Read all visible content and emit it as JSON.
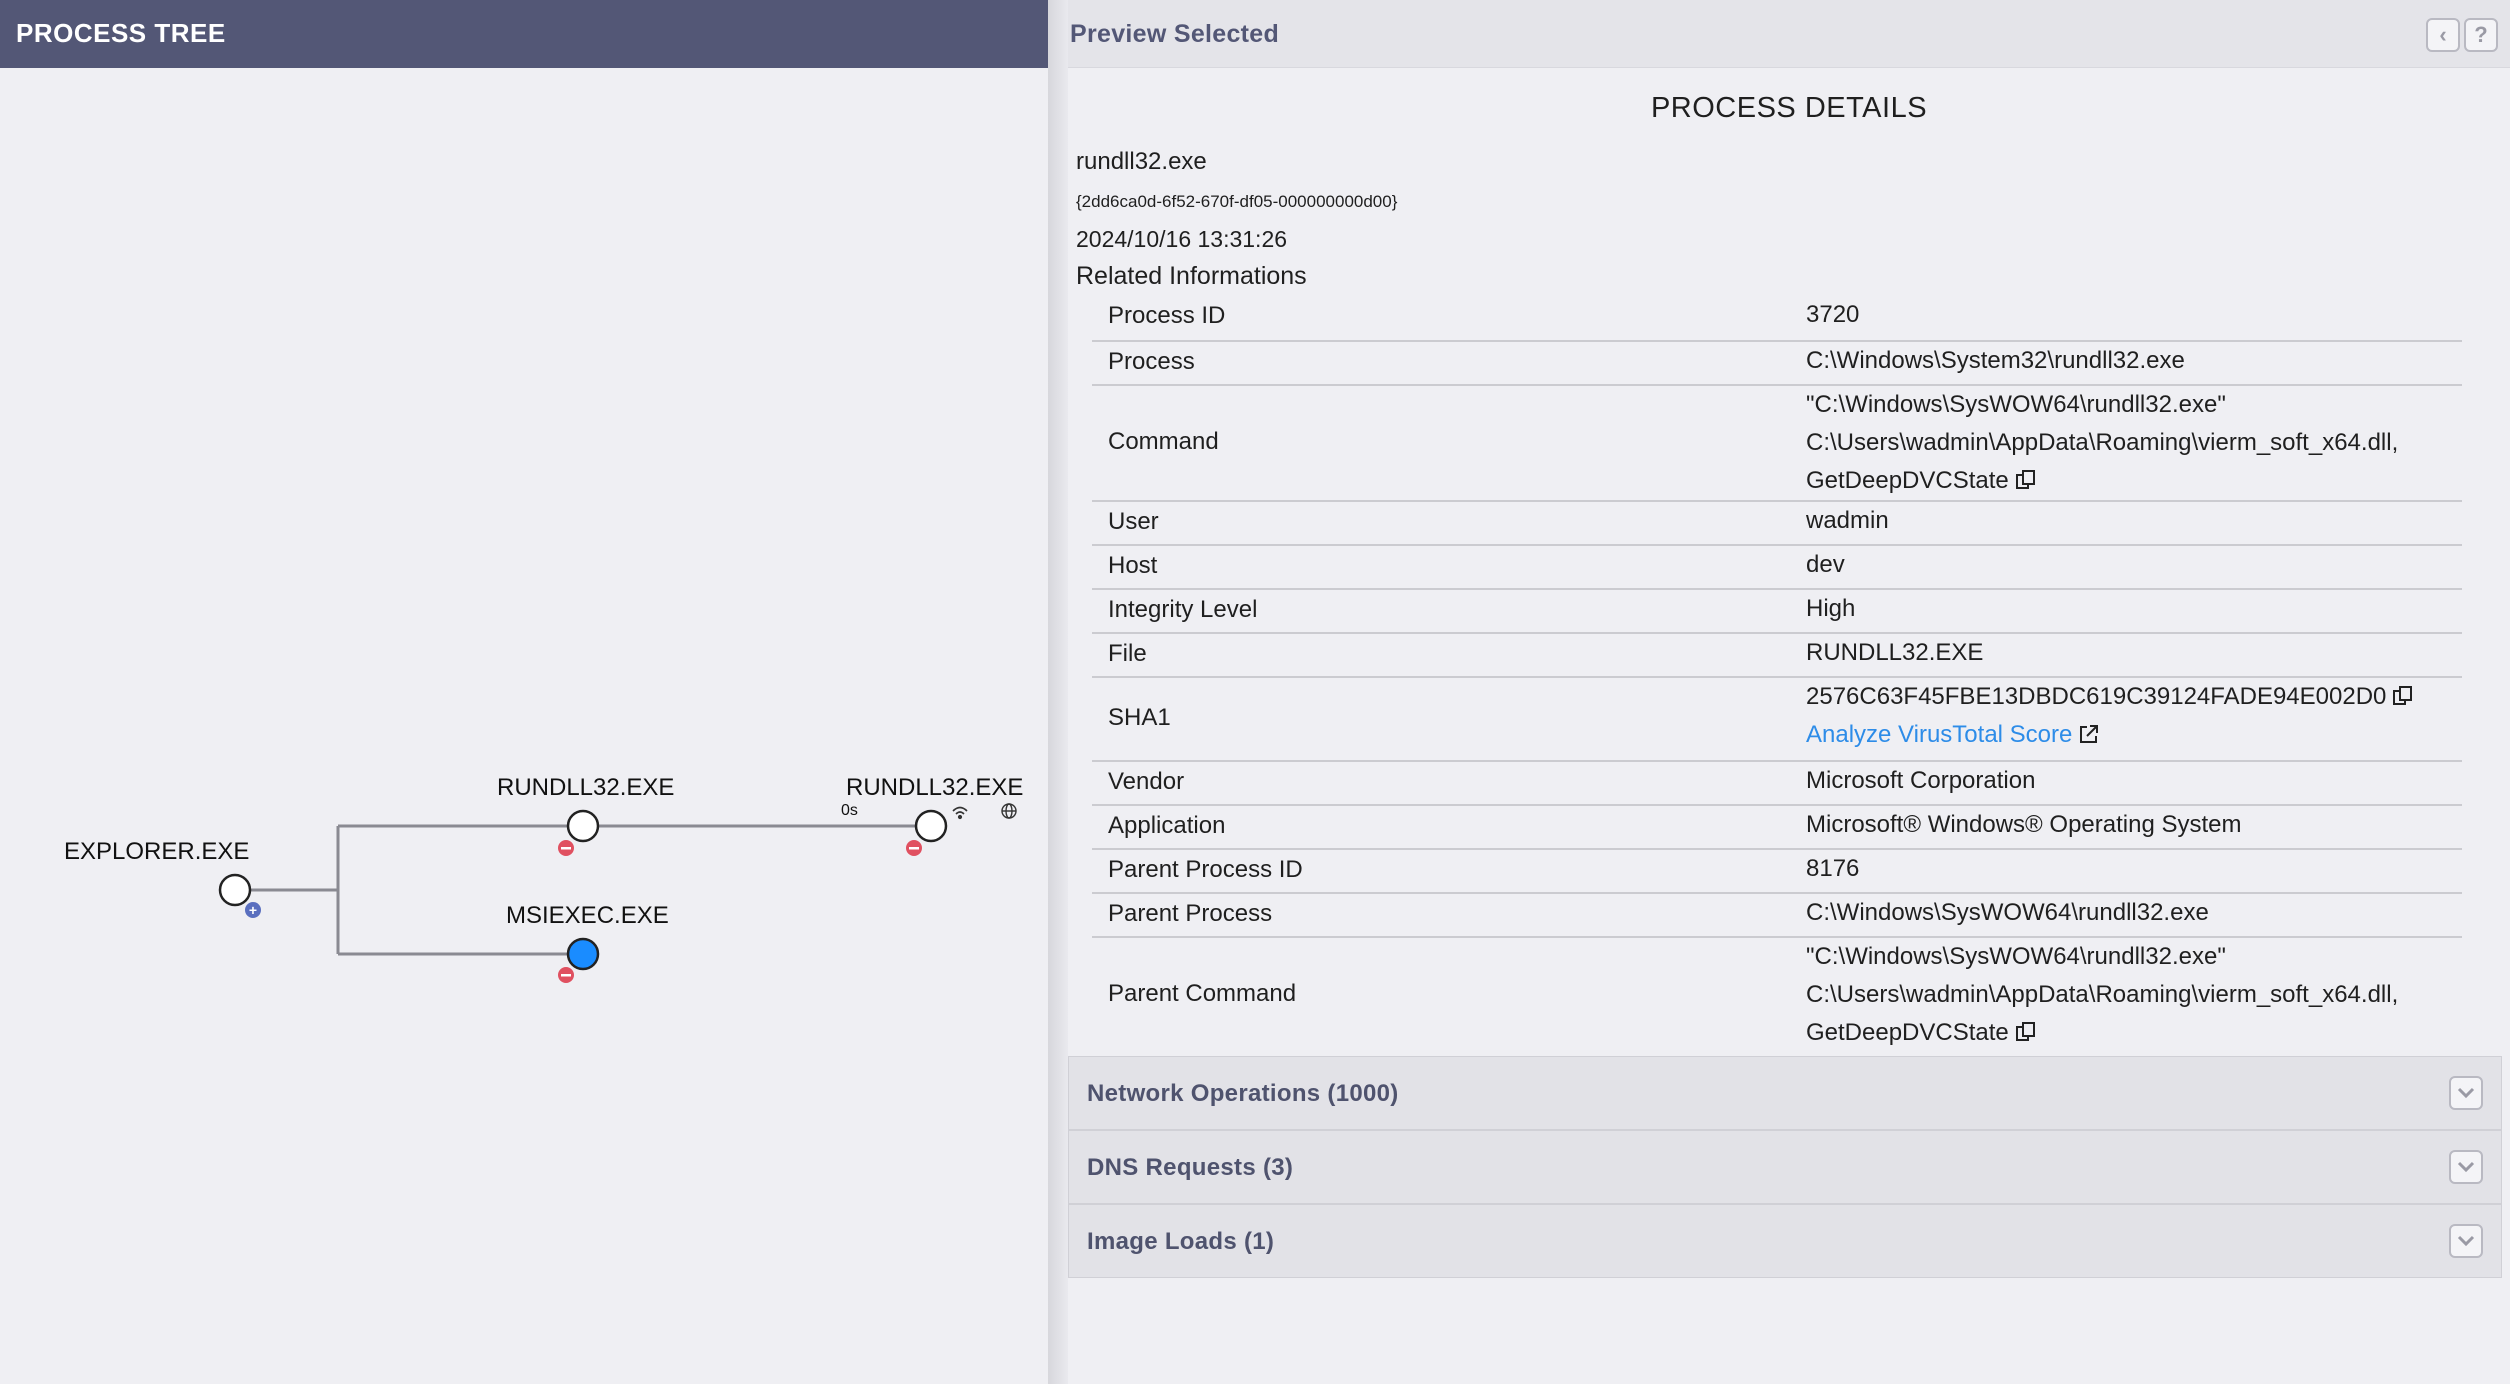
{
  "left_panel": {
    "title": "PROCESS TREE",
    "nodes": {
      "explorer": "EXPLORER.EXE",
      "rundll32_child": "RUNDLL32.EXE",
      "rundll32_grandchild": "RUNDLL32.EXE",
      "msiexec": "MSIEXEC.EXE"
    },
    "time_label": "0s"
  },
  "right_panel": {
    "title": "Preview Selected",
    "section_title": "PROCESS DETAILS",
    "process_name": "rundll32.exe",
    "process_guid": "{2dd6ca0d-6f52-670f-df05-000000000d00}",
    "timestamp": "2024/10/16 13:31:26",
    "related_label": "Related Informations",
    "details": {
      "process_id": {
        "key": "Process ID",
        "value": "3720"
      },
      "process": {
        "key": "Process",
        "value": "C:\\Windows\\System32\\rundll32.exe"
      },
      "command": {
        "key": "Command",
        "line1": "\"C:\\Windows\\SysWOW64\\rundll32.exe\"",
        "line2": "C:\\Users\\wadmin\\AppData\\Roaming\\vierm_soft_x64.dll,",
        "line3": "GetDeepDVCState"
      },
      "user": {
        "key": "User",
        "value": "wadmin"
      },
      "host": {
        "key": "Host",
        "value": "dev"
      },
      "integrity": {
        "key": "Integrity Level",
        "value": "High"
      },
      "file": {
        "key": "File",
        "value": "RUNDLL32.EXE"
      },
      "sha1": {
        "key": "SHA1",
        "value": "2576C63F45FBE13DBDC619C39124FADE94E002D0",
        "link": "Analyze VirusTotal Score"
      },
      "vendor": {
        "key": "Vendor",
        "value": "Microsoft Corporation"
      },
      "application": {
        "key": "Application",
        "value": "Microsoft® Windows® Operating System"
      },
      "parent_pid": {
        "key": "Parent Process ID",
        "value": "8176"
      },
      "parent_process": {
        "key": "Parent Process",
        "value": "C:\\Windows\\SysWOW64\\rundll32.exe"
      },
      "parent_command": {
        "key": "Parent Command",
        "line1": "\"C:\\Windows\\SysWOW64\\rundll32.exe\"",
        "line2": "C:\\Users\\wadmin\\AppData\\Roaming\\vierm_soft_x64.dll,",
        "line3": "GetDeepDVCState"
      }
    },
    "accordions": {
      "network": "Network Operations (1000)",
      "dns": "DNS Requests (3)",
      "image_loads": "Image Loads (1)"
    }
  },
  "colors": {
    "header_bg": "#535776",
    "selected_node": "#1a8cff",
    "remove_badge": "#e05060",
    "expand_badge": "#5a6fbf",
    "link": "#2d8ce8"
  },
  "icons": [
    "back-icon",
    "help-icon",
    "copy-icon",
    "external-link-icon",
    "wifi-icon",
    "globe-icon",
    "chevron-down-icon"
  ]
}
